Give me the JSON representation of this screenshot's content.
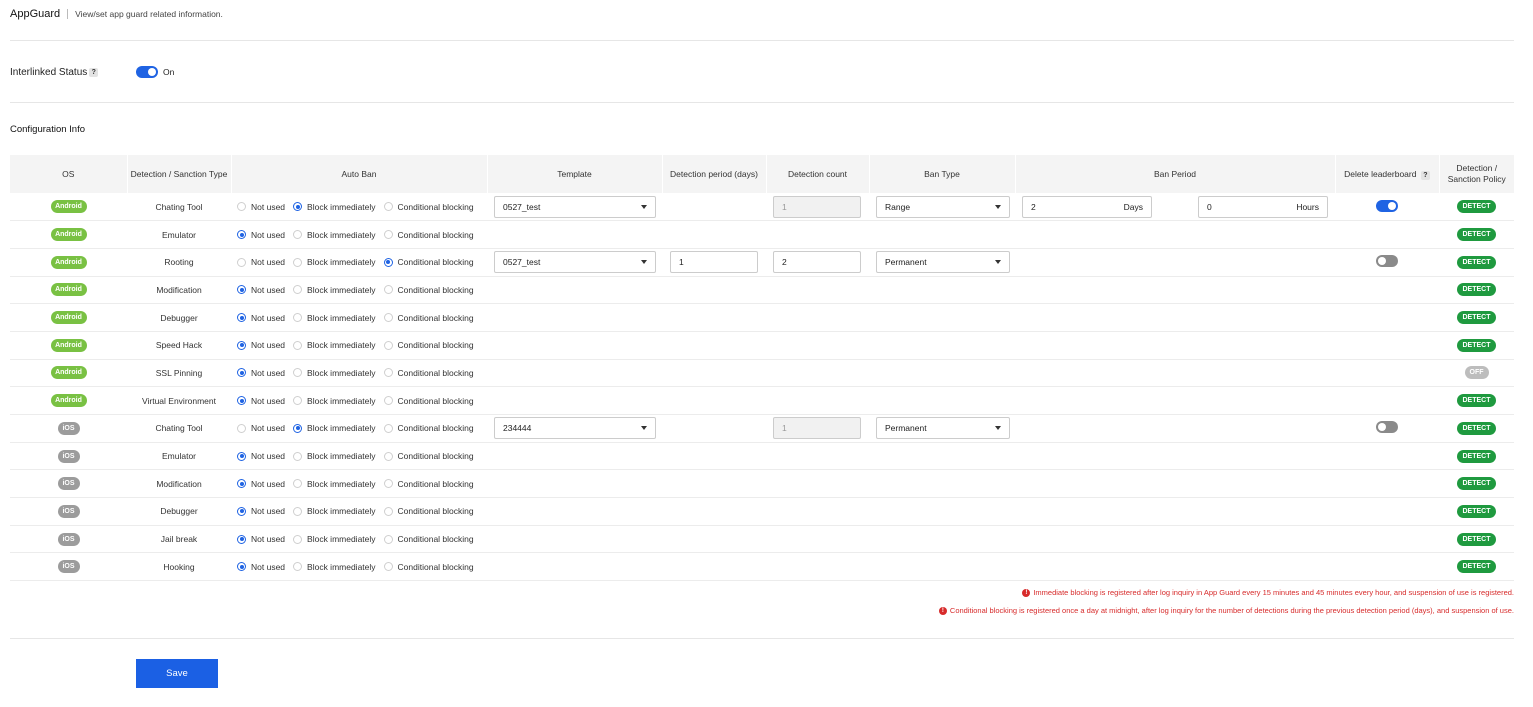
{
  "header": {
    "title": "AppGuard",
    "description": "View/set app guard related information."
  },
  "interlinked": {
    "label": "Interlinked Status",
    "help": "?",
    "state": "On"
  },
  "config": {
    "title": "Configuration Info",
    "columns": {
      "os": "OS",
      "type": "Detection / Sanction Type",
      "auto_ban": "Auto Ban",
      "template": "Template",
      "period": "Detection period (days)",
      "count": "Detection count",
      "ban_type": "Ban Type",
      "ban_period": "Ban Period",
      "leaderboard": "Delete leaderboard",
      "leaderboard_help": "?",
      "policy": "Detection / Sanction Policy"
    },
    "radio_labels": [
      "Not used",
      "Block immediately",
      "Conditional blocking"
    ],
    "rows": [
      {
        "os": "Android",
        "type": "Chating Tool",
        "ban": 1,
        "template": "0527_test",
        "period": "",
        "count": "1",
        "count_disabled": true,
        "ban_type": "Range",
        "days": "2",
        "days_unit": "Days",
        "hours": "0",
        "hours_unit": "Hours",
        "leaderboard": "on",
        "policy": "DETECT"
      },
      {
        "os": "Android",
        "type": "Emulator",
        "ban": 0,
        "policy": "DETECT"
      },
      {
        "os": "Android",
        "type": "Rooting",
        "ban": 2,
        "template": "0527_test",
        "period": "1",
        "count": "2",
        "count_disabled": false,
        "ban_type": "Permanent",
        "leaderboard": "off",
        "policy": "DETECT"
      },
      {
        "os": "Android",
        "type": "Modification",
        "ban": 0,
        "policy": "DETECT"
      },
      {
        "os": "Android",
        "type": "Debugger",
        "ban": 0,
        "policy": "DETECT"
      },
      {
        "os": "Android",
        "type": "Speed Hack",
        "ban": 0,
        "policy": "DETECT"
      },
      {
        "os": "Android",
        "type": "SSL Pinning",
        "ban": 0,
        "policy": "OFF"
      },
      {
        "os": "Android",
        "type": "Virtual Environment",
        "ban": 0,
        "policy": "DETECT"
      },
      {
        "os": "iOS",
        "type": "Chating Tool",
        "ban": 1,
        "template": "234444",
        "count": "1",
        "count_disabled": true,
        "ban_type": "Permanent",
        "leaderboard": "off",
        "policy": "DETECT"
      },
      {
        "os": "iOS",
        "type": "Emulator",
        "ban": 0,
        "policy": "DETECT"
      },
      {
        "os": "iOS",
        "type": "Modification",
        "ban": 0,
        "policy": "DETECT"
      },
      {
        "os": "iOS",
        "type": "Debugger",
        "ban": 0,
        "policy": "DETECT"
      },
      {
        "os": "iOS",
        "type": "Jail break",
        "ban": 0,
        "policy": "DETECT"
      },
      {
        "os": "iOS",
        "type": "Hooking",
        "ban": 0,
        "policy": "DETECT"
      }
    ]
  },
  "notes": {
    "icon": "!",
    "immediate": "Immediate blocking is registered after log inquiry in App Guard every 15 minutes and 45 minutes every hour, and suspension of use is registered.",
    "conditional": "Conditional blocking is registered once a day at midnight, after log inquiry for the number of detections during the previous detection period (days), and suspension of use."
  },
  "save_label": "Save",
  "colors": {
    "accent": "#1f63e3",
    "android": "#79c143",
    "ios": "#9c9c9c",
    "detect": "#1f9a3f",
    "off": "#bdbdbd",
    "warning": "#d72b2b"
  }
}
